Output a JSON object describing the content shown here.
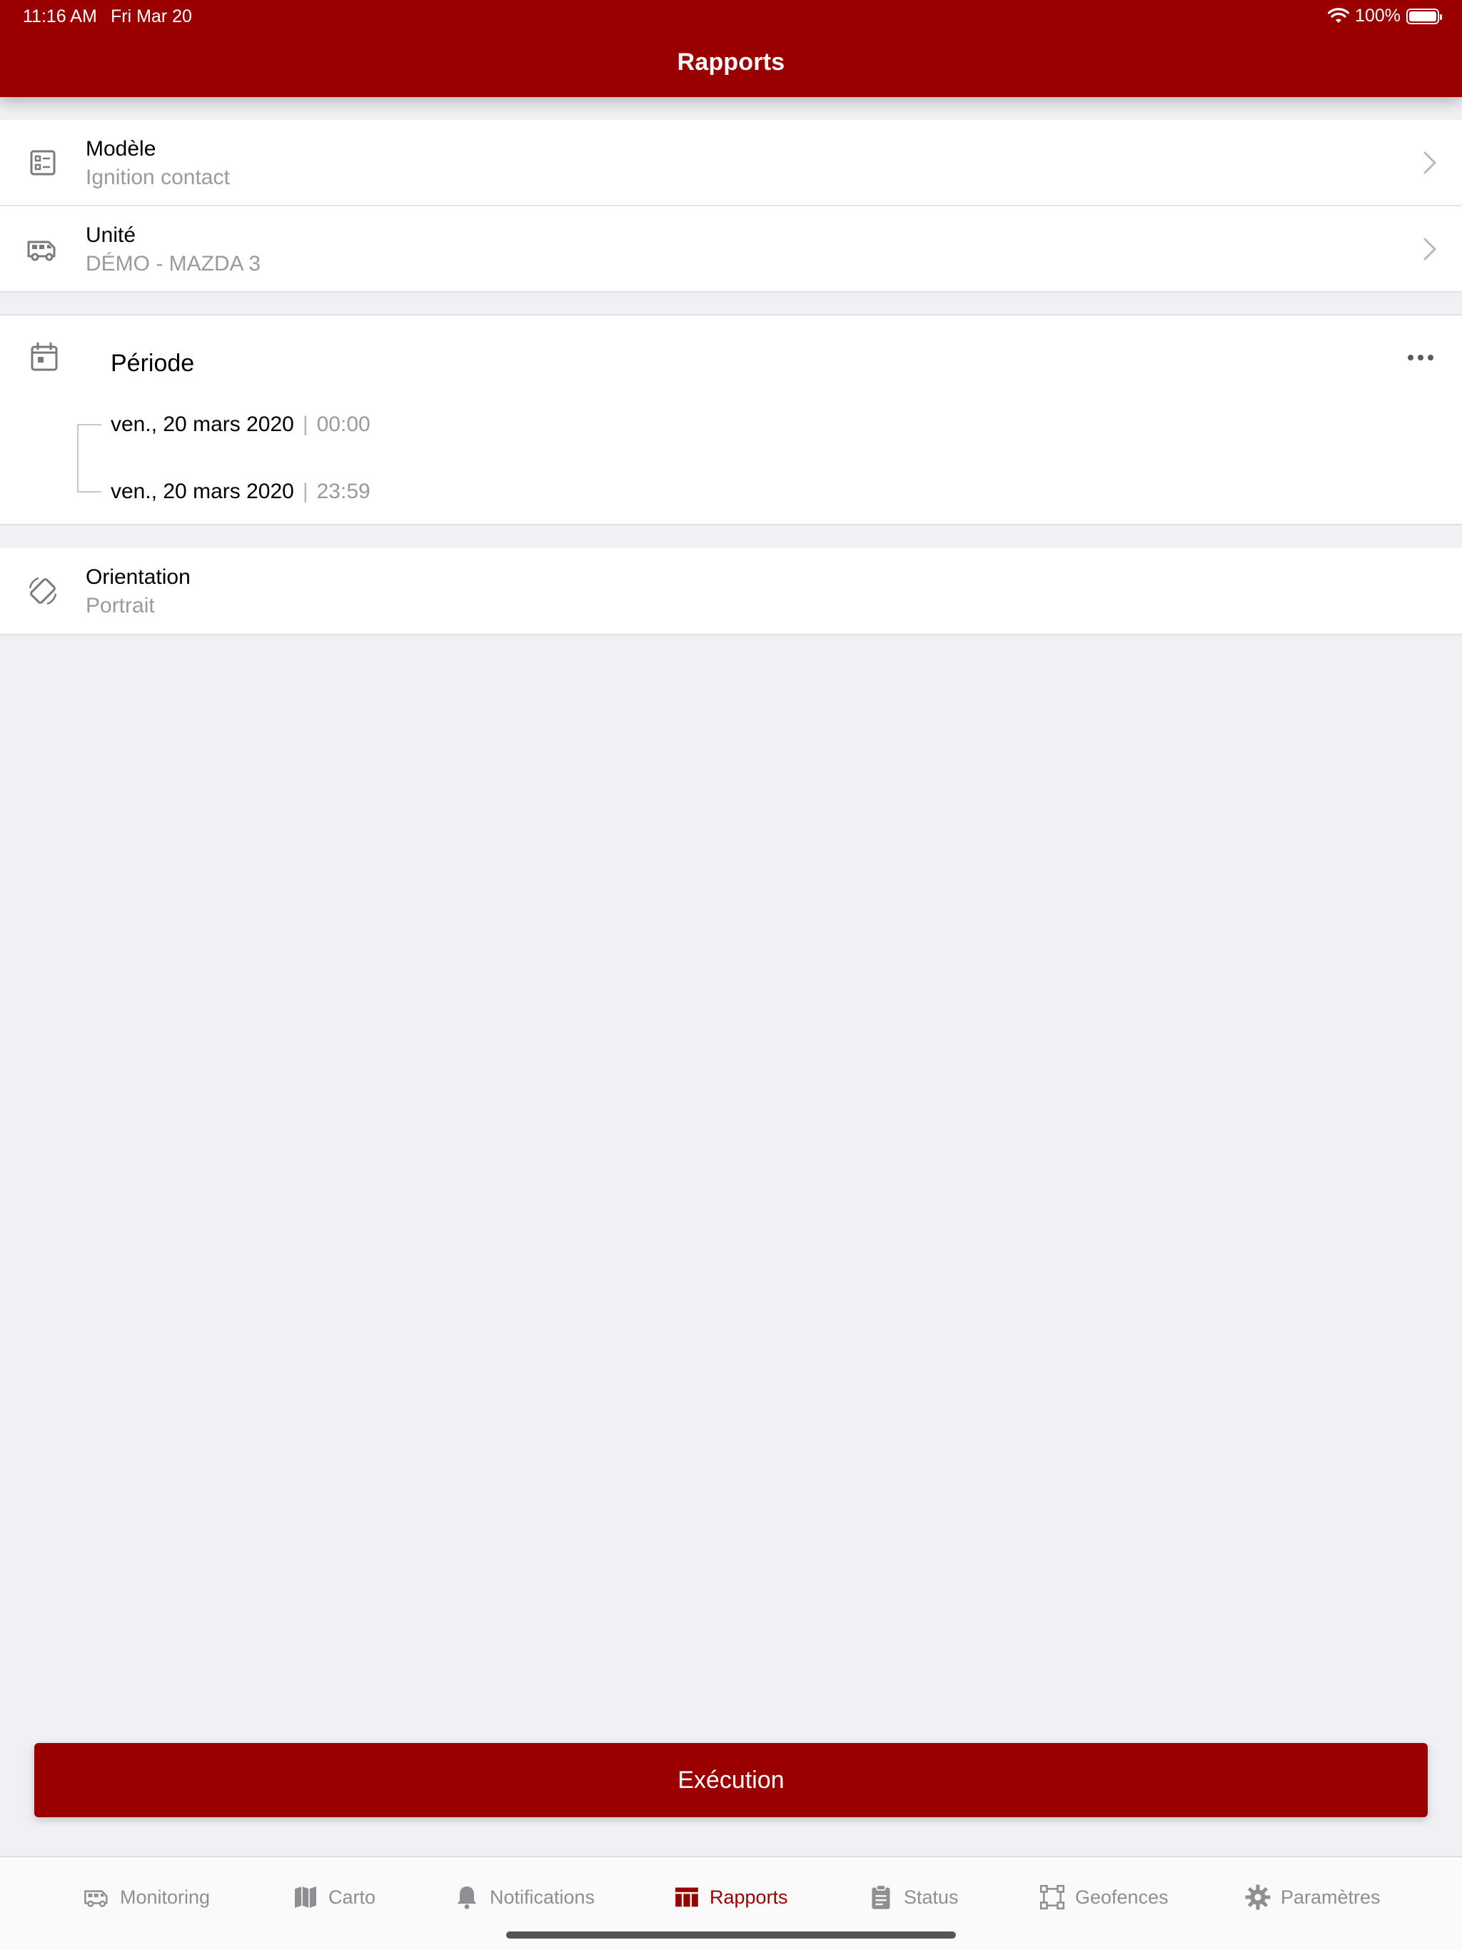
{
  "status_bar": {
    "time": "11:16 AM",
    "date": "Fri Mar 20",
    "battery": "100%"
  },
  "header": {
    "title": "Rapports"
  },
  "form": {
    "model": {
      "label": "Modèle",
      "value": "Ignition contact",
      "icon": "template-icon"
    },
    "unit": {
      "label": "Unité",
      "value": "DÉMO - MAZDA 3",
      "icon": "van-icon"
    },
    "period": {
      "label": "Période",
      "icon": "calendar-icon",
      "start_date": "ven., 20 mars 2020",
      "start_time": "00:00",
      "end_date": "ven., 20 mars 2020",
      "end_time": "23:59",
      "separator": "|"
    },
    "orientation": {
      "label": "Orientation",
      "value": "Portrait",
      "icon": "rotate-icon"
    }
  },
  "execute_button": {
    "label": "Exécution"
  },
  "tabs": [
    {
      "label": "Monitoring",
      "icon": "van-icon"
    },
    {
      "label": "Carto",
      "icon": "map-icon"
    },
    {
      "label": "Notifications",
      "icon": "bell-icon"
    },
    {
      "label": "Rapports",
      "icon": "table-icon",
      "active": true
    },
    {
      "label": "Status",
      "icon": "clipboard-icon"
    },
    {
      "label": "Geofences",
      "icon": "geofence-icon"
    },
    {
      "label": "Paramètres",
      "icon": "gear-icon"
    }
  ],
  "colors": {
    "brand": "#9b0000",
    "background": "#efeff4",
    "secondary_text": "#9a9a9a",
    "inactive_tab": "#8e8e93"
  }
}
